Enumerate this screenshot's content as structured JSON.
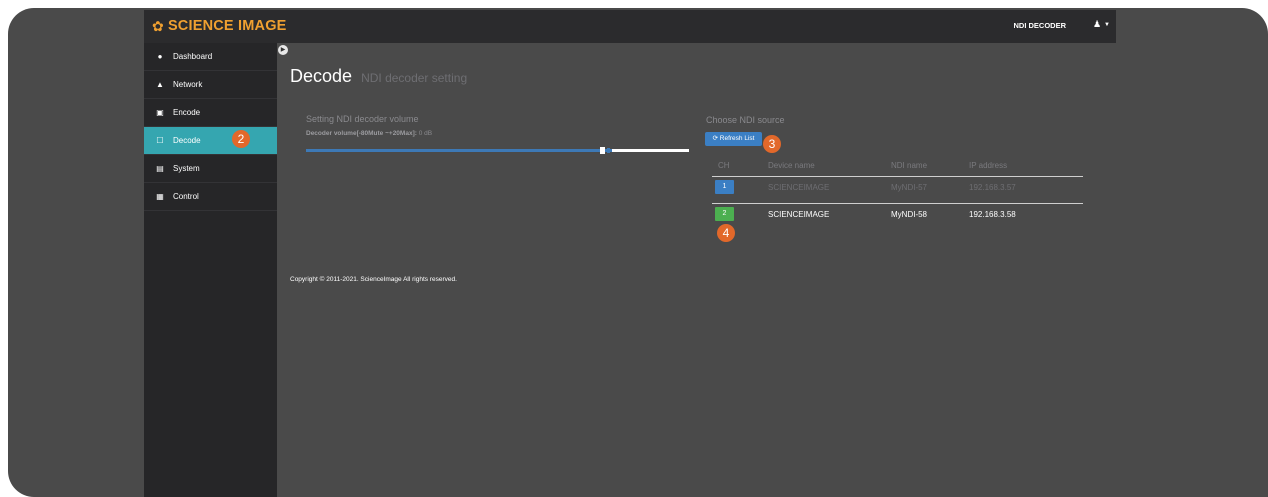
{
  "brand": {
    "name": "SCIENCE IMAGE",
    "icon": "gear-icon",
    "color": "#f0a030"
  },
  "header": {
    "device": "NDI DECODER",
    "user_icon": "user-icon",
    "caret_icon": "caret-down-icon"
  },
  "sidebar": {
    "items": [
      {
        "label": "Dashboard",
        "icon": "dashboard-icon"
      },
      {
        "label": "Network",
        "icon": "network-icon"
      },
      {
        "label": "Encode",
        "icon": "image-icon"
      },
      {
        "label": "Decode",
        "icon": "monitor-icon",
        "active": true
      },
      {
        "label": "System",
        "icon": "list-icon"
      },
      {
        "label": "Control",
        "icon": "grid-icon"
      }
    ],
    "active_color": "#35a6b0"
  },
  "page": {
    "title": "Decode",
    "subtitle": "NDI decoder setting"
  },
  "volume": {
    "title": "Setting NDI decoder volume",
    "label": "Decoder volume[-80Mute ~+20Max]:",
    "value": "0 dB",
    "fill_fraction": 0.8
  },
  "source": {
    "title": "Choose NDI source",
    "refresh_label": "Refresh List",
    "columns": [
      "CH",
      "Device name",
      "NDI name",
      "IP address"
    ],
    "rows": [
      {
        "ch": "1",
        "device": "SCIENCEIMAGE",
        "ndi": "MyNDI-57",
        "ip": "192.168.3.57",
        "color": "#3b7fc4"
      },
      {
        "ch": "2",
        "device": "SCIENCEIMAGE",
        "ndi": "MyNDI-58",
        "ip": "192.168.3.58",
        "color": "#4caf50"
      }
    ]
  },
  "callouts": {
    "c2": "2",
    "c3": "3",
    "c4": "4",
    "color": "#e2682a"
  },
  "footer": {
    "copyright": "Copyright © 2011-2021. ScienceImage All rights reserved."
  }
}
